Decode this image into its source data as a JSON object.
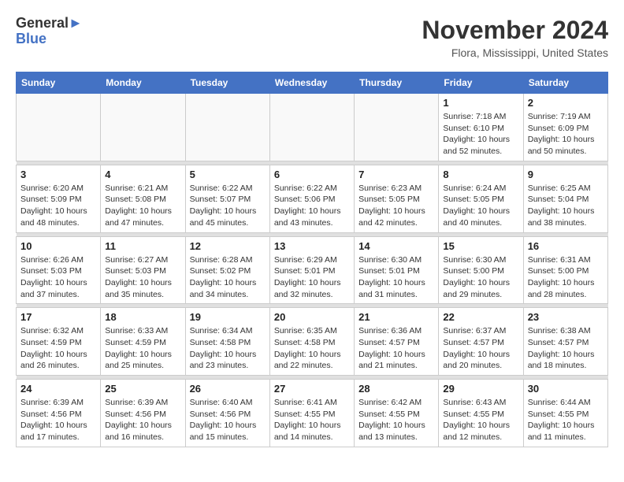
{
  "header": {
    "logo_general": "General",
    "logo_blue": "Blue",
    "month": "November 2024",
    "location": "Flora, Mississippi, United States"
  },
  "weekdays": [
    "Sunday",
    "Monday",
    "Tuesday",
    "Wednesday",
    "Thursday",
    "Friday",
    "Saturday"
  ],
  "weeks": [
    [
      {
        "day": "",
        "info": ""
      },
      {
        "day": "",
        "info": ""
      },
      {
        "day": "",
        "info": ""
      },
      {
        "day": "",
        "info": ""
      },
      {
        "day": "",
        "info": ""
      },
      {
        "day": "1",
        "info": "Sunrise: 7:18 AM\nSunset: 6:10 PM\nDaylight: 10 hours\nand 52 minutes."
      },
      {
        "day": "2",
        "info": "Sunrise: 7:19 AM\nSunset: 6:09 PM\nDaylight: 10 hours\nand 50 minutes."
      }
    ],
    [
      {
        "day": "3",
        "info": "Sunrise: 6:20 AM\nSunset: 5:09 PM\nDaylight: 10 hours\nand 48 minutes."
      },
      {
        "day": "4",
        "info": "Sunrise: 6:21 AM\nSunset: 5:08 PM\nDaylight: 10 hours\nand 47 minutes."
      },
      {
        "day": "5",
        "info": "Sunrise: 6:22 AM\nSunset: 5:07 PM\nDaylight: 10 hours\nand 45 minutes."
      },
      {
        "day": "6",
        "info": "Sunrise: 6:22 AM\nSunset: 5:06 PM\nDaylight: 10 hours\nand 43 minutes."
      },
      {
        "day": "7",
        "info": "Sunrise: 6:23 AM\nSunset: 5:05 PM\nDaylight: 10 hours\nand 42 minutes."
      },
      {
        "day": "8",
        "info": "Sunrise: 6:24 AM\nSunset: 5:05 PM\nDaylight: 10 hours\nand 40 minutes."
      },
      {
        "day": "9",
        "info": "Sunrise: 6:25 AM\nSunset: 5:04 PM\nDaylight: 10 hours\nand 38 minutes."
      }
    ],
    [
      {
        "day": "10",
        "info": "Sunrise: 6:26 AM\nSunset: 5:03 PM\nDaylight: 10 hours\nand 37 minutes."
      },
      {
        "day": "11",
        "info": "Sunrise: 6:27 AM\nSunset: 5:03 PM\nDaylight: 10 hours\nand 35 minutes."
      },
      {
        "day": "12",
        "info": "Sunrise: 6:28 AM\nSunset: 5:02 PM\nDaylight: 10 hours\nand 34 minutes."
      },
      {
        "day": "13",
        "info": "Sunrise: 6:29 AM\nSunset: 5:01 PM\nDaylight: 10 hours\nand 32 minutes."
      },
      {
        "day": "14",
        "info": "Sunrise: 6:30 AM\nSunset: 5:01 PM\nDaylight: 10 hours\nand 31 minutes."
      },
      {
        "day": "15",
        "info": "Sunrise: 6:30 AM\nSunset: 5:00 PM\nDaylight: 10 hours\nand 29 minutes."
      },
      {
        "day": "16",
        "info": "Sunrise: 6:31 AM\nSunset: 5:00 PM\nDaylight: 10 hours\nand 28 minutes."
      }
    ],
    [
      {
        "day": "17",
        "info": "Sunrise: 6:32 AM\nSunset: 4:59 PM\nDaylight: 10 hours\nand 26 minutes."
      },
      {
        "day": "18",
        "info": "Sunrise: 6:33 AM\nSunset: 4:59 PM\nDaylight: 10 hours\nand 25 minutes."
      },
      {
        "day": "19",
        "info": "Sunrise: 6:34 AM\nSunset: 4:58 PM\nDaylight: 10 hours\nand 23 minutes."
      },
      {
        "day": "20",
        "info": "Sunrise: 6:35 AM\nSunset: 4:58 PM\nDaylight: 10 hours\nand 22 minutes."
      },
      {
        "day": "21",
        "info": "Sunrise: 6:36 AM\nSunset: 4:57 PM\nDaylight: 10 hours\nand 21 minutes."
      },
      {
        "day": "22",
        "info": "Sunrise: 6:37 AM\nSunset: 4:57 PM\nDaylight: 10 hours\nand 20 minutes."
      },
      {
        "day": "23",
        "info": "Sunrise: 6:38 AM\nSunset: 4:57 PM\nDaylight: 10 hours\nand 18 minutes."
      }
    ],
    [
      {
        "day": "24",
        "info": "Sunrise: 6:39 AM\nSunset: 4:56 PM\nDaylight: 10 hours\nand 17 minutes."
      },
      {
        "day": "25",
        "info": "Sunrise: 6:39 AM\nSunset: 4:56 PM\nDaylight: 10 hours\nand 16 minutes."
      },
      {
        "day": "26",
        "info": "Sunrise: 6:40 AM\nSunset: 4:56 PM\nDaylight: 10 hours\nand 15 minutes."
      },
      {
        "day": "27",
        "info": "Sunrise: 6:41 AM\nSunset: 4:55 PM\nDaylight: 10 hours\nand 14 minutes."
      },
      {
        "day": "28",
        "info": "Sunrise: 6:42 AM\nSunset: 4:55 PM\nDaylight: 10 hours\nand 13 minutes."
      },
      {
        "day": "29",
        "info": "Sunrise: 6:43 AM\nSunset: 4:55 PM\nDaylight: 10 hours\nand 12 minutes."
      },
      {
        "day": "30",
        "info": "Sunrise: 6:44 AM\nSunset: 4:55 PM\nDaylight: 10 hours\nand 11 minutes."
      }
    ]
  ]
}
